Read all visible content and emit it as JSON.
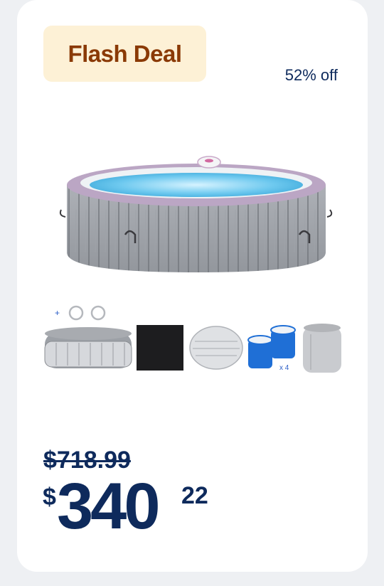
{
  "deal": {
    "badge_label": "Flash Deal",
    "discount_text": "52% off"
  },
  "product": {
    "image_icon": "hot-tub-image",
    "accessories": [
      {
        "name": "spa-cover-with-clips",
        "icon": "cover-icon"
      },
      {
        "name": "ground-mat",
        "icon": "mat-icon"
      },
      {
        "name": "floor-protector",
        "icon": "protector-icon"
      },
      {
        "name": "filter-cartridges",
        "icon": "filter-icon",
        "label": "x 4"
      },
      {
        "name": "storage-bag",
        "icon": "bag-icon"
      }
    ]
  },
  "pricing": {
    "old_price": "$718.99",
    "currency": "$",
    "price_integer": "340",
    "price_cents": "22"
  },
  "colors": {
    "badge_bg": "#fdf1d6",
    "badge_text": "#8a3a06",
    "price_text": "#0e2a5c",
    "card_bg": "#ffffff",
    "page_bg": "#eef0f3"
  }
}
